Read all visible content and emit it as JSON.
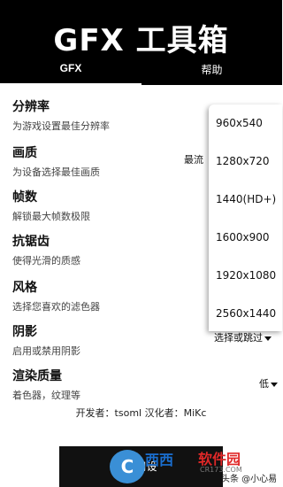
{
  "header": {
    "title": "GFX 工具箱",
    "tabs": [
      {
        "label": "GFX",
        "active": true
      },
      {
        "label": "帮助",
        "active": false
      }
    ],
    "background": "#000000"
  },
  "settings": [
    {
      "title": "分辨率",
      "desc": "为游戏设置最佳分辨率"
    },
    {
      "title": "画质",
      "desc": "为设备选择最佳画质",
      "value": "最流"
    },
    {
      "title": "帧数",
      "desc": "解锁最大帧数极限"
    },
    {
      "title": "抗锯齿",
      "desc": "使得光滑的质感"
    },
    {
      "title": "风格",
      "desc": "选择您喜欢的滤色器"
    },
    {
      "title": "阴影",
      "desc": "启用或禁用阴影",
      "value": "选择或跳过"
    },
    {
      "title": "渲染质量",
      "desc": "着色器，纹理等",
      "value": "低"
    }
  ],
  "resolution_dropdown": {
    "options": [
      "960x540",
      "1280x720",
      "1440(HD+)",
      "1600x900",
      "1920x1080",
      "2560x1440"
    ]
  },
  "footer": {
    "credits": "开发者：tsoml   汉化者：MiKc"
  },
  "apply_button": {
    "label": "应用设"
  },
  "watermark": {
    "brand_blue": "西西",
    "brand_red": "软件园",
    "sub": "CR173.COM",
    "credit": "头条 @小心易乐"
  },
  "colors": {
    "accent": "#000000",
    "watermark_blue": "#1a6fd1",
    "watermark_red": "#e02828"
  }
}
